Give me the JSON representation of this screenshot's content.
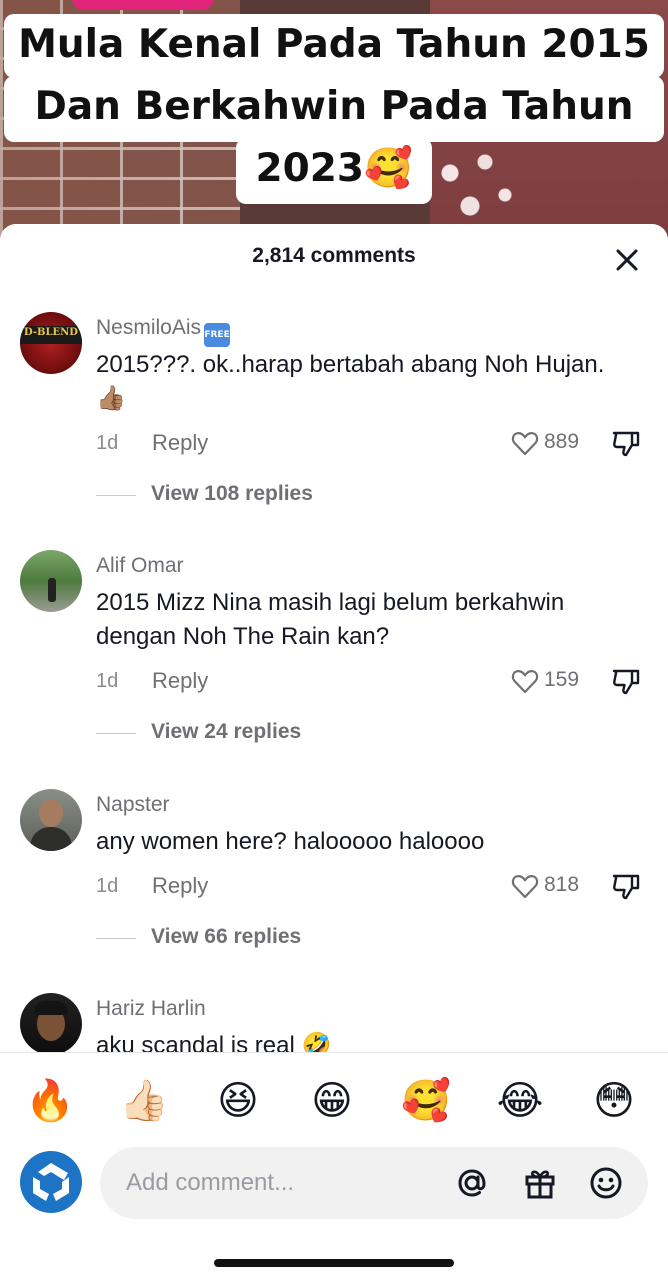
{
  "video": {
    "caption_lines": [
      "Mula Kenal Pada Tahun 2015",
      "Dan Berkahwin Pada Tahun",
      "2023🥰"
    ]
  },
  "comments_sheet": {
    "title": "2,814 comments",
    "comments": [
      {
        "username": "NesmiloAis",
        "badge": "FREE",
        "avatar_text": "D-BLEND",
        "text": "2015???. ok..harap bertabah abang Noh Hujan. 👍🏽",
        "time": "1d",
        "reply_label": "Reply",
        "likes": "889",
        "view_replies": "View 108 replies"
      },
      {
        "username": "Alif Omar",
        "text": "2015 Mizz Nina masih lagi belum berkahwin dengan Noh The Rain kan?",
        "time": "1d",
        "reply_label": "Reply",
        "likes": "159",
        "view_replies": "View 24 replies"
      },
      {
        "username": "Napster",
        "text": "any women here? halooooo haloooo",
        "time": "1d",
        "reply_label": "Reply",
        "likes": "818",
        "view_replies": "View 66 replies"
      },
      {
        "username": "Hariz Harlin",
        "text": "aku scandal is real 🤣"
      }
    ]
  },
  "emoji_bar": [
    "🔥",
    "👍🏻",
    "😆",
    "😁",
    "🥰",
    "😂",
    "😳"
  ],
  "composer": {
    "placeholder": "Add comment...",
    "icons": [
      "at-icon",
      "gift-icon",
      "emoji-icon"
    ]
  },
  "colors": {
    "text_primary": "#161823",
    "text_secondary": "#6f6f75",
    "avatar_blue": "#1d74c4",
    "caption_tag_pink": "#e0247a"
  }
}
